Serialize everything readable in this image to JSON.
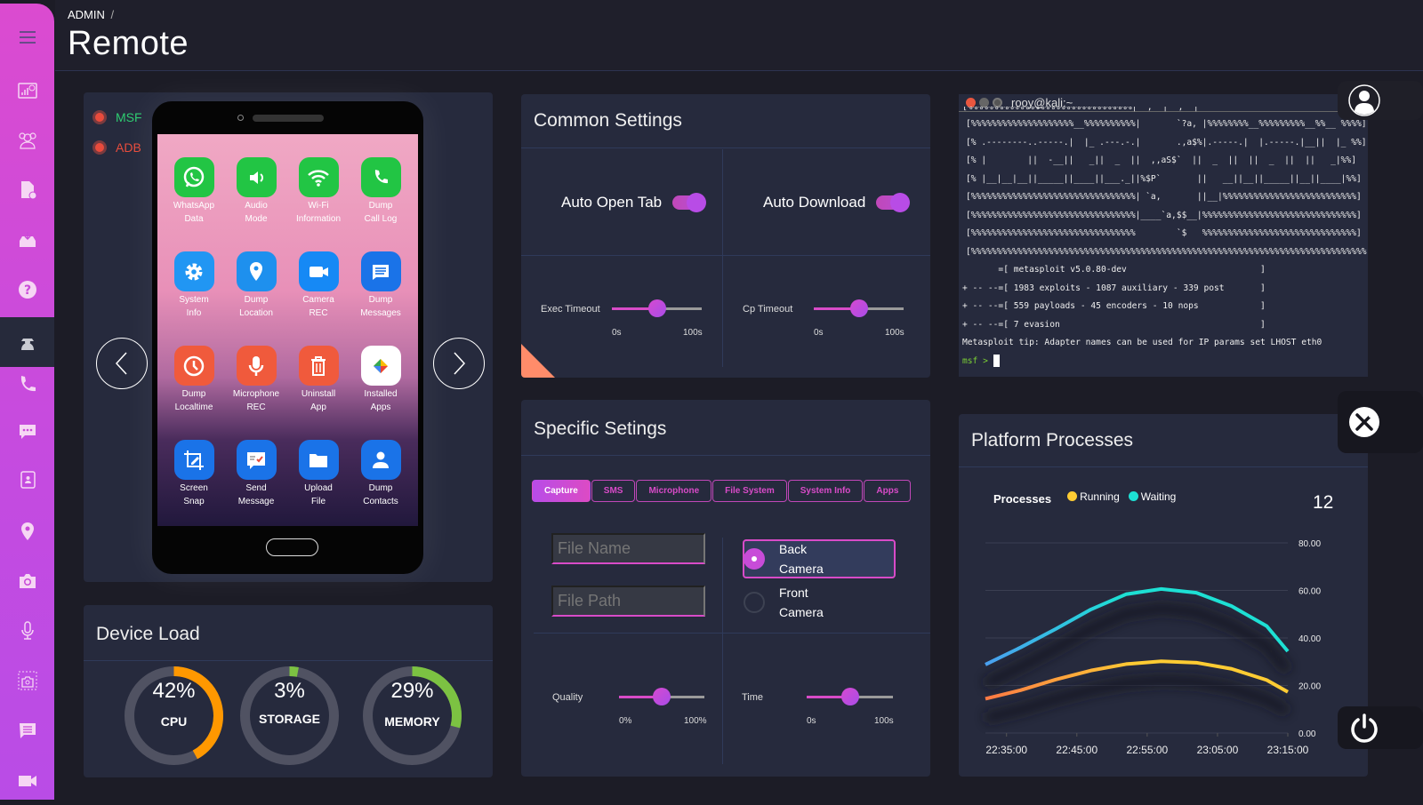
{
  "header": {
    "breadcrumb": "ADMIN",
    "breadcrumb_sep": "/",
    "title": "Remote"
  },
  "sidebar": {
    "items": [
      {
        "name": "menu",
        "icon": "hamburger-icon"
      },
      {
        "name": "dashboard",
        "icon": "dashboard-chart-icon"
      },
      {
        "name": "users",
        "icon": "users-icon"
      },
      {
        "name": "add-document",
        "icon": "document-add-icon"
      },
      {
        "name": "download",
        "icon": "drive-download-icon"
      },
      {
        "name": "help",
        "icon": "help-icon"
      },
      {
        "name": "spy",
        "icon": "spy-icon",
        "active": true
      },
      {
        "name": "calls",
        "icon": "phone-icon"
      },
      {
        "name": "chat",
        "icon": "chat-icon"
      },
      {
        "name": "contacts",
        "icon": "contacts-book-icon"
      },
      {
        "name": "location",
        "icon": "location-pin-icon"
      },
      {
        "name": "camera",
        "icon": "camera-icon"
      },
      {
        "name": "microphone",
        "icon": "microphone-icon"
      },
      {
        "name": "screenshot",
        "icon": "screenshot-camera-icon"
      },
      {
        "name": "messages",
        "icon": "message-icon"
      },
      {
        "name": "video",
        "icon": "video-icon"
      }
    ]
  },
  "status": {
    "msf": {
      "label": "MSF",
      "color": "#2ecc71"
    },
    "adb": {
      "label": "ADB",
      "color": "#e74c3c"
    }
  },
  "phone_apps": [
    {
      "line1": "WhatsApp",
      "line2": "Data",
      "icon": "whatsapp-icon",
      "color": "#22c544"
    },
    {
      "line1": "Audio",
      "line2": "Mode",
      "icon": "speaker-icon",
      "color": "#22c544"
    },
    {
      "line1": "Wi-Fi",
      "line2": "Information",
      "icon": "wifi-icon",
      "color": "#22c544"
    },
    {
      "line1": "Dump",
      "line2": "Call Log",
      "icon": "phone-icon",
      "color": "#22c544"
    },
    {
      "line1": "System",
      "line2": "Info",
      "icon": "gear-icon",
      "color": "#2196f3"
    },
    {
      "line1": "Dump",
      "line2": "Location",
      "icon": "location-pin-icon",
      "color": "#1e90ee"
    },
    {
      "line1": "Camera",
      "line2": "REC",
      "icon": "video-camera-icon",
      "color": "#1689f5"
    },
    {
      "line1": "Dump",
      "line2": "Messages",
      "icon": "message-icon",
      "color": "#1a73e8"
    },
    {
      "line1": "Dump",
      "line2": "Localtime",
      "icon": "clock-icon",
      "color": "#f05a3c"
    },
    {
      "line1": "Microphone",
      "line2": "REC",
      "icon": "microphone-icon",
      "color": "#f05a3c"
    },
    {
      "line1": "Uninstall",
      "line2": "App",
      "icon": "trash-icon",
      "color": "#f05a3c"
    },
    {
      "line1": "Installed",
      "line2": "Apps",
      "icon": "play-services-icon",
      "color": "#ffffff"
    },
    {
      "line1": "Screen",
      "line2": "Snap",
      "icon": "screen-crop-icon",
      "color": "#1a73e8"
    },
    {
      "line1": "Send",
      "line2": "Message",
      "icon": "send-message-icon",
      "color": "#1a73e8"
    },
    {
      "line1": "Upload",
      "line2": "File",
      "icon": "folder-icon",
      "color": "#1a73e8"
    },
    {
      "line1": "Dump",
      "line2": "Contacts",
      "icon": "contact-person-icon",
      "color": "#1a73e8"
    }
  ],
  "device_load": {
    "title": "Device Load",
    "gauges": [
      {
        "label": "CPU",
        "value_text": "42%",
        "value": 42,
        "color": "#ff9800"
      },
      {
        "label": "STORAGE",
        "value_text": "3%",
        "value": 3,
        "color": "#7cc242"
      },
      {
        "label": "MEMORY",
        "value_text": "29%",
        "value": 29,
        "color": "#7cc242"
      }
    ]
  },
  "common_settings": {
    "title": "Common Settings",
    "toggles": [
      {
        "label": "Auto Open Tab",
        "on": true
      },
      {
        "label": "Auto Download",
        "on": true
      }
    ],
    "sliders": [
      {
        "label": "Exec Timeout",
        "min": "0s",
        "max": "100s",
        "value": 50
      },
      {
        "label": "Cp Timeout",
        "min": "0s",
        "max": "100s",
        "value": 50
      }
    ]
  },
  "specific_settings": {
    "title": "Specific Setings",
    "tabs": [
      {
        "label": "Capture",
        "active": true
      },
      {
        "label": "SMS"
      },
      {
        "label": "Microphone"
      },
      {
        "label": "File System"
      },
      {
        "label": "System Info"
      },
      {
        "label": "Apps"
      }
    ],
    "file_name_placeholder": "File Name",
    "file_path_placeholder": "File Path",
    "camera_options": [
      {
        "line1": "Back",
        "line2": "Camera",
        "selected": true
      },
      {
        "line1": "Front",
        "line2": "Camera",
        "selected": false
      }
    ],
    "sliders": [
      {
        "label": "Quality",
        "min": "0%",
        "max": "100%",
        "value": 50
      },
      {
        "label": "Time",
        "min": "0s",
        "max": "100s",
        "value": 50
      }
    ]
  },
  "terminal": {
    "title": "rooy@kali:~",
    "lines": [
      "[%%%%%%%%%%%%%%%%%%%%__%%%%%%%%%%|       `?a, |%%%%%%%%__%%%%%%%%%__%%__ %%%%]",
      "[% .--------..-----.|  |_ .---.-.|       .,a$%|.-----.|  |.-----.|__||  |_ %%]",
      "[% |        ||  -__||   _||  _  ||  ,,aS$`  ||  _  ||  ||  _  ||  ||   _|%%]",
      "[% |__|__|__||_____||____||___._||%$P`       ||   __||__||_____||__||____|%%]",
      "[%%%%%%%%%%%%%%%%%%%%%%%%%%%%%%%%| `a,       ||__|%%%%%%%%%%%%%%%%%%%%%%%%%%]",
      "[%%%%%%%%%%%%%%%%%%%%%%%%%%%%%%%%|____`a,$$__|%%%%%%%%%%%%%%%%%%%%%%%%%%%%%%]",
      "[%%%%%%%%%%%%%%%%%%%%%%%%%%%%%%%%        `$   %%%%%%%%%%%%%%%%%%%%%%%%%%%%%%]",
      "[%%%%%%%%%%%%%%%%%%%%%%%%%%%%%%%%%%%%%%%%%%%%%%%%%%%%%%%%%%%%%%%%%%%%%%%%%%%%%]",
      "       =[ metasploit v5.0.80-dev                          ]",
      "+ -- --=[ 1983 exploits - 1087 auxiliary - 339 post       ]",
      "+ -- --=[ 559 payloads - 45 encoders - 10 nops            ]",
      "+ -- --=[ 7 evasion                                       ]",
      "Metasploit tip: Adapter names can be used for IP params set LHOST eth0"
    ],
    "prompt": "msf >"
  },
  "float_buttons": [
    {
      "name": "profile",
      "icon": "user-avatar-icon"
    },
    {
      "name": "tools",
      "icon": "tools-icon"
    },
    {
      "name": "power",
      "icon": "power-icon"
    }
  ],
  "chart_data": {
    "type": "line",
    "title": "Platform Processes",
    "legend_title": "Processes",
    "legend": [
      "Running",
      "Waiting"
    ],
    "legend_position": "top-left",
    "counter": "12",
    "x": [
      "22:32",
      "22:37",
      "22:42",
      "22:47",
      "22:52",
      "22:57",
      "23:02",
      "23:07",
      "23:12",
      "23:15"
    ],
    "x_ticks": [
      "22:35:00",
      "22:45:00",
      "22:55:00",
      "23:05:00",
      "23:15:00"
    ],
    "y_ticks": [
      "0.00",
      "20.00",
      "40.00",
      "60.00",
      "80.00"
    ],
    "ylim": [
      0,
      80
    ],
    "grid": true,
    "series": [
      {
        "name": "Running",
        "color": "#ffcc33",
        "values": [
          14.4,
          18,
          22.5,
          26.3,
          29,
          30.2,
          29.6,
          27,
          22.3,
          17.3
        ]
      },
      {
        "name": "Waiting",
        "color": "#1de0d4",
        "values": [
          28.8,
          36,
          43.8,
          52,
          58.4,
          60.6,
          59,
          53.4,
          45,
          34.4
        ]
      }
    ]
  }
}
